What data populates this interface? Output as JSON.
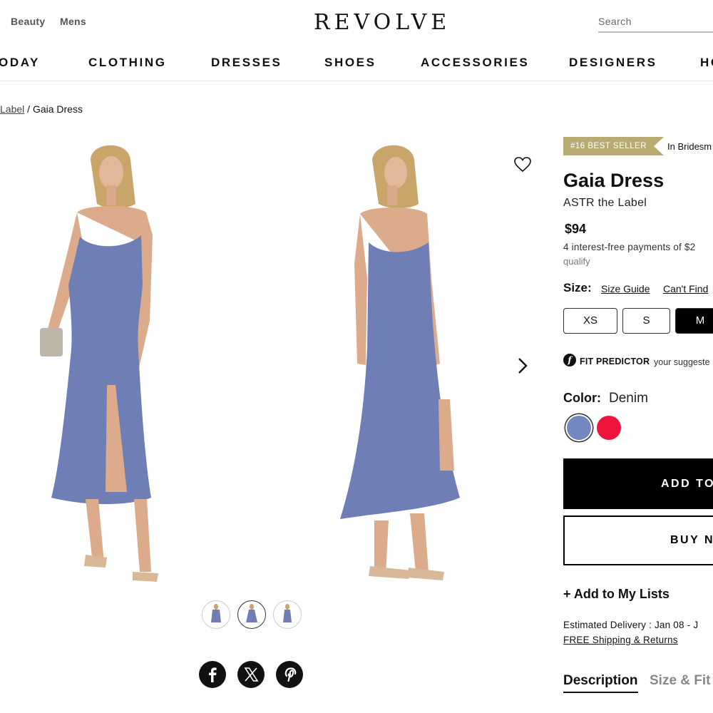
{
  "header": {
    "top_links": [
      "Beauty",
      "Mens"
    ],
    "logo": "REVOLVE",
    "search_placeholder": "Search"
  },
  "nav": {
    "items": [
      "ODAY",
      "CLOTHING",
      "DRESSES",
      "SHOES",
      "ACCESSORIES",
      "DESIGNERS",
      "HO"
    ]
  },
  "breadcrumb": {
    "parent": "Label",
    "separator": "/",
    "current": "Gaia Dress"
  },
  "gallery": {
    "wishlist_icon": "heart-icon",
    "next_icon": "chevron-right-icon",
    "thumbnail_count": 3,
    "selected_thumbnail": 2,
    "share_icons": [
      "facebook-icon",
      "x-icon",
      "pinterest-icon"
    ]
  },
  "product": {
    "badge": "#16 BEST SELLER",
    "badge_context": "In Bridesm",
    "title": "Gaia Dress",
    "brand": "ASTR the Label",
    "price": "$94",
    "installments": "4 interest-free payments of $2",
    "qualify": "qualify",
    "size_label": "Size:",
    "size_guide": "Size Guide",
    "cant_find": "Can't Find",
    "sizes": [
      "XS",
      "S",
      "M"
    ],
    "selected_size": "M",
    "fit_icon": "f",
    "fit_title": "FIT PREDICTOR",
    "fit_text": "your suggeste",
    "color_label": "Color:",
    "color_value": "Denim",
    "swatches": [
      {
        "name": "Denim",
        "color": "#7587c0",
        "selected": true
      },
      {
        "name": "Red",
        "color": "#f0143c",
        "selected": false
      }
    ],
    "add_button": "ADD TO",
    "buy_button": "BUY N",
    "add_to_lists": "+ Add to My Lists",
    "delivery": "Estimated Delivery : Jan 08 - J",
    "shipping": "FREE Shipping & Returns",
    "tabs": [
      "Description",
      "Size & Fit"
    ]
  },
  "colors": {
    "dress": "#6f7fb5",
    "badge": "#b8ab72",
    "accent_red": "#f0143c"
  }
}
